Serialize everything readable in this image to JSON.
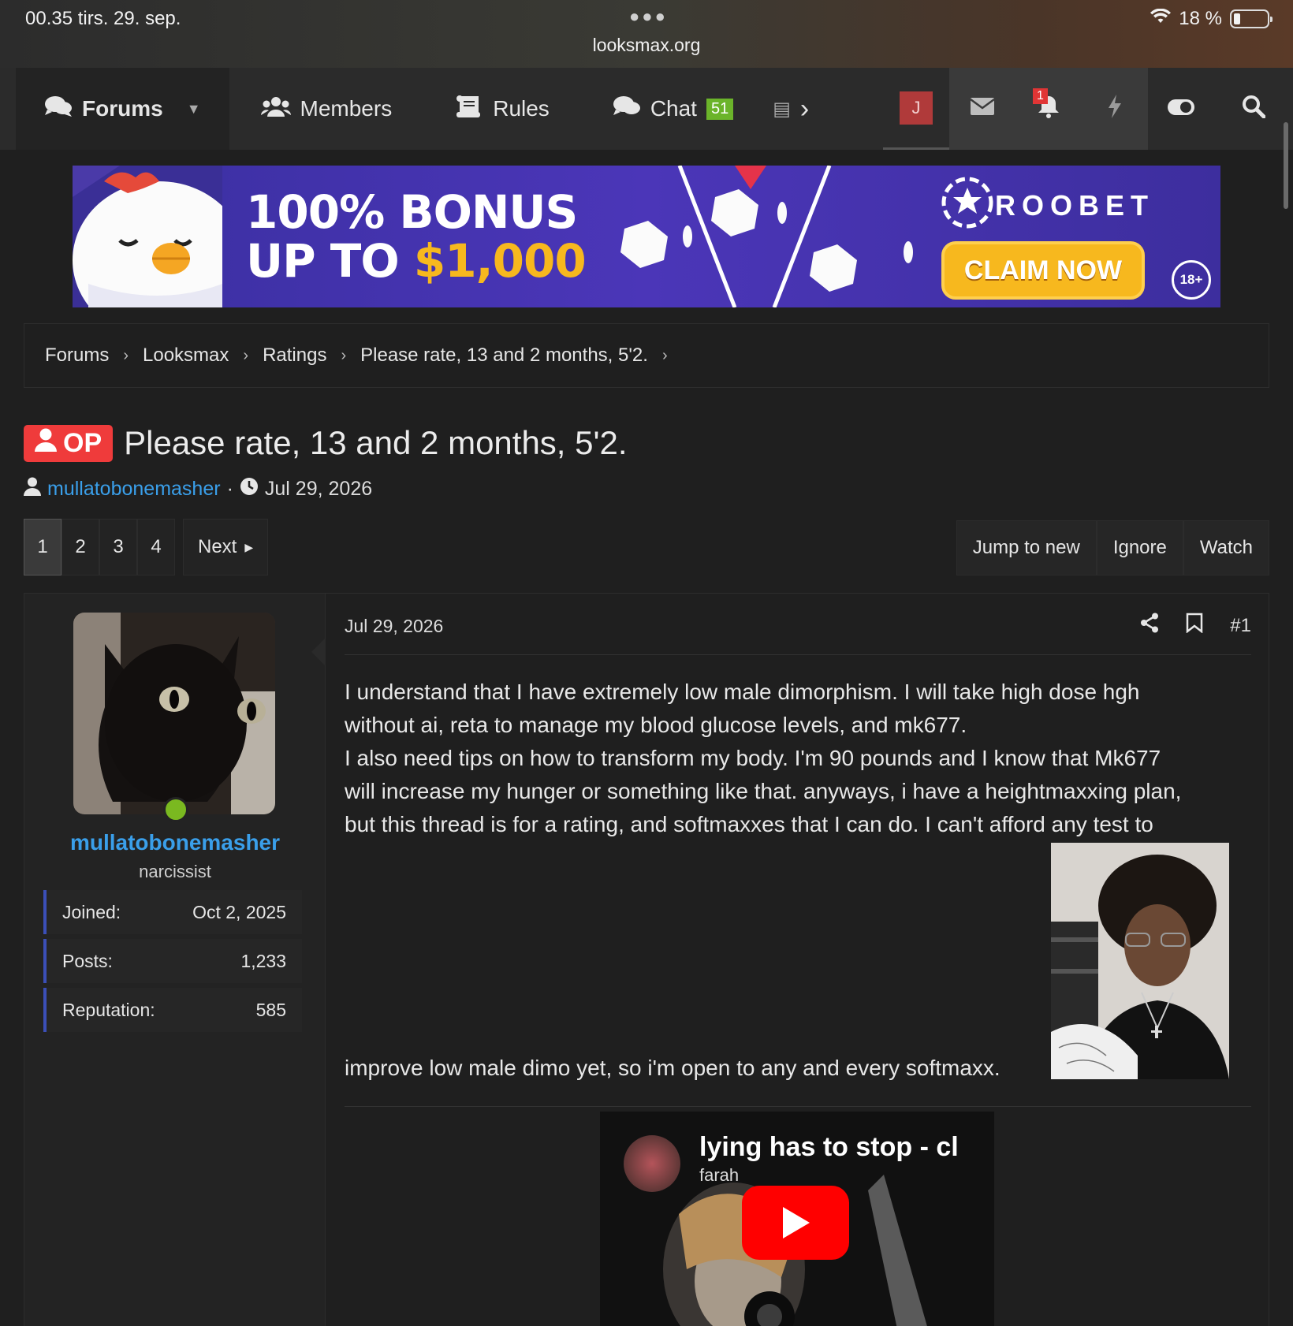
{
  "status_bar": {
    "time_date": "00.35   tirs. 29. sep.",
    "url": "looksmax.org",
    "battery": "18 %"
  },
  "nav": {
    "items": [
      {
        "label": "Forums",
        "icon": "comments-icon"
      },
      {
        "label": "Members",
        "icon": "users-icon"
      },
      {
        "label": "Rules",
        "icon": "scroll-icon"
      },
      {
        "label": "Chat",
        "icon": "chat-icon",
        "badge": "51"
      }
    ],
    "avatar_letter": "J",
    "alerts_count": "1"
  },
  "ad": {
    "line1": "100% BONUS",
    "line2_prefix": "UP TO ",
    "line2_amount": "$1,000",
    "brand": "ROOBET",
    "cta": "CLAIM NOW",
    "age": "18+"
  },
  "breadcrumb": [
    "Forums",
    "Looksmax",
    "Ratings",
    "Please rate, 13 and 2 months, 5'2."
  ],
  "thread": {
    "op_label": "OP",
    "title": "Please rate, 13 and 2 months, 5'2.",
    "author": "mullatobonemasher",
    "date": "Jul 29, 2026"
  },
  "pager": {
    "pages": [
      "1",
      "2",
      "3",
      "4"
    ],
    "current": "1",
    "next_label": "Next"
  },
  "thread_actions": [
    "Jump to new",
    "Ignore",
    "Watch"
  ],
  "post": {
    "user": {
      "name": "mullatobonemasher",
      "title": "narcissist",
      "stats": [
        {
          "label": "Joined:",
          "value": "Oct 2, 2025"
        },
        {
          "label": "Posts:",
          "value": "1,233"
        },
        {
          "label": "Reputation:",
          "value": "585"
        }
      ]
    },
    "date": "Jul 29, 2026",
    "number": "#1",
    "body_lines": [
      "I understand that I have extremely low male dimorphism. I will take high dose hgh",
      "without ai, reta to manage my blood glucose levels, and mk677.",
      "I also need tips on how to transform my body. I'm 90 pounds and I know that Mk677",
      "will increase my hunger or something like that. anyways, i have a heightmaxxing plan,",
      "but this thread is for a rating, and softmaxxes that I can do. I can't afford any test to"
    ],
    "body_tail": "improve low male dimo yet, so i'm open to any and every softmaxx.",
    "video": {
      "title": "lying has to stop - cl",
      "channel": "farah"
    }
  }
}
